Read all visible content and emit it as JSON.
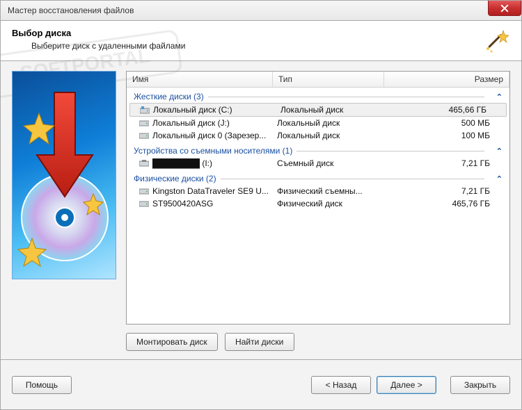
{
  "window": {
    "title": "Мастер восстановления файлов"
  },
  "header": {
    "title": "Выбор диска",
    "subtitle": "Выберите диск с удаленными файлами"
  },
  "columns": {
    "name": "Имя",
    "type": "Тип",
    "size": "Размер"
  },
  "groups": [
    {
      "label": "Жесткие диски (3)",
      "rows": [
        {
          "name": "Локальный диск (C:)",
          "type": "Локальный диск",
          "size": "465,66 ГБ",
          "icon": "system-drive",
          "selected": true
        },
        {
          "name": "Локальный диск (J:)",
          "type": "Локальный диск",
          "size": "500 МБ",
          "icon": "hdd"
        },
        {
          "name": "Локальный диск 0 (Зарезер...",
          "type": "Локальный диск",
          "size": "100 МБ",
          "icon": "hdd"
        }
      ]
    },
    {
      "label": "Устройства со съемными носителями (1)",
      "rows": [
        {
          "name": "████████ (I:)",
          "type": "Съемный диск",
          "size": "7,21 ГБ",
          "icon": "removable"
        }
      ]
    },
    {
      "label": "Физические диски (2)",
      "rows": [
        {
          "name": "Kingston DataTraveler SE9 U...",
          "type": "Физический съемны...",
          "size": "7,21 ГБ",
          "icon": "hdd"
        },
        {
          "name": "ST9500420ASG",
          "type": "Физический диск",
          "size": "465,76 ГБ",
          "icon": "hdd"
        }
      ]
    }
  ],
  "buttons": {
    "mount": "Монтировать диск",
    "find": "Найти диски",
    "help": "Помощь",
    "back": "< Назад",
    "next": "Далее >",
    "close": "Закрыть"
  },
  "watermark": "SOFTPORTAL"
}
